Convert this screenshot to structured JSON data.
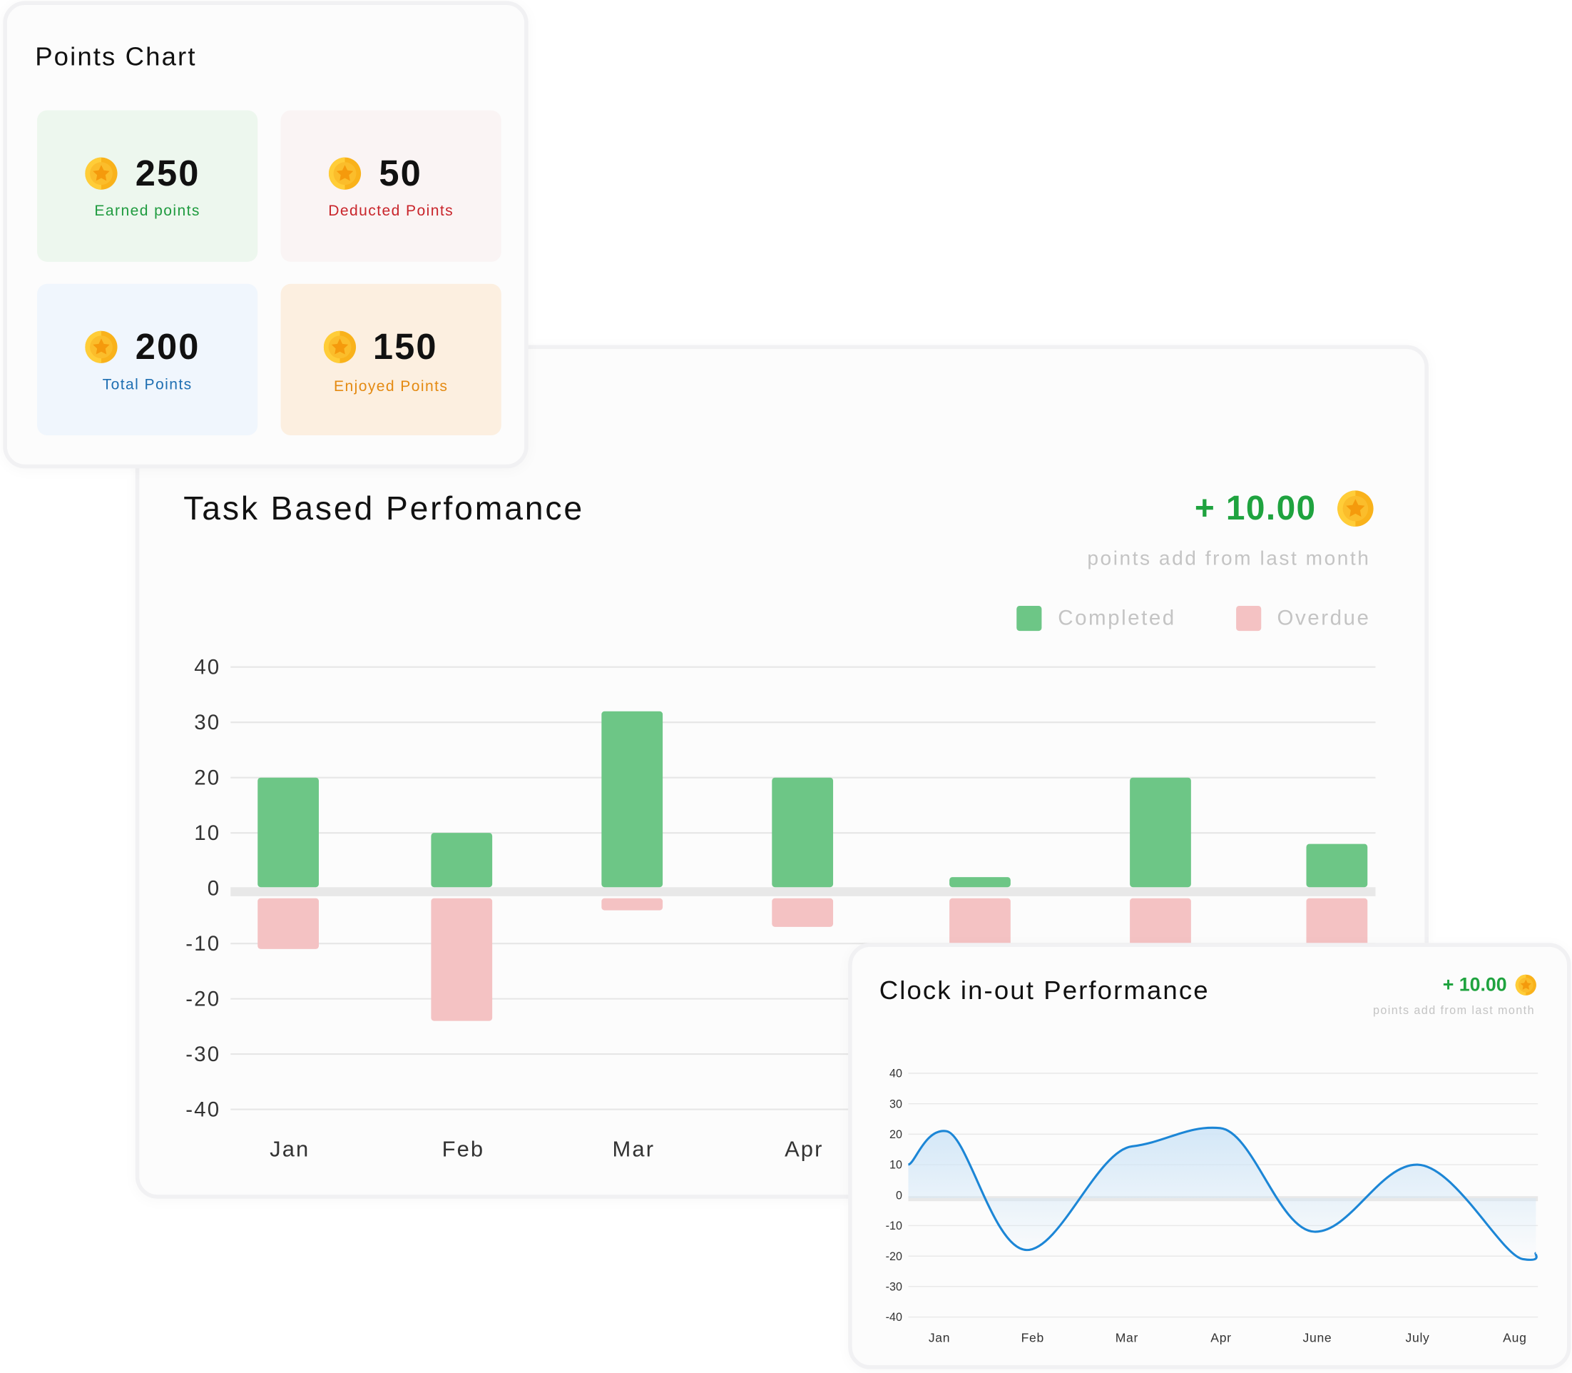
{
  "points_card": {
    "title": "Points Chart",
    "tiles": [
      {
        "value": "250",
        "label": "Earned points",
        "label_color": "#1f9b3f",
        "bg": "#edf7ee"
      },
      {
        "value": "50",
        "label": "Deducted Points",
        "label_color": "#c9252b",
        "bg": "#faf4f4"
      },
      {
        "value": "200",
        "label": "Total Points",
        "label_color": "#1f6fb2",
        "bg": "#f0f6fd"
      },
      {
        "value": "150",
        "label": "Enjoyed Points",
        "label_color": "#e48a12",
        "bg": "#fcefe0"
      }
    ]
  },
  "task_card": {
    "title": "Task Based Perfomance",
    "delta": "+ 10.00",
    "delta_sub": "points add from last month"
  },
  "clock_card": {
    "title": "Clock in-out Performance",
    "delta": "+ 10.00",
    "delta_sub": "points add from last month"
  },
  "colors": {
    "positive": "#1fa33f",
    "completed": "#6dc686",
    "overdue": "#f4c2c3",
    "line": "#1c86d6"
  },
  "chart_data": [
    {
      "type": "bar",
      "title": "Task Based Perfomance",
      "categories": [
        "Jan",
        "Feb",
        "Mar",
        "Apr",
        "",
        "",
        ""
      ],
      "series": [
        {
          "name": "Completed",
          "values": [
            20,
            10,
            32,
            20,
            2,
            20,
            8
          ]
        },
        {
          "name": "Overdue",
          "values": [
            -11,
            -24,
            -4,
            -7,
            -12,
            -11,
            -11
          ]
        }
      ],
      "yticks": [
        "40",
        "30",
        "20",
        "10",
        "0",
        "-10",
        "-20",
        "-30",
        "-40"
      ],
      "ylim": [
        -40,
        40
      ],
      "grid": true,
      "legend": "top-right"
    },
    {
      "type": "line",
      "title": "Clock in-out Performance",
      "categories": [
        "Jan",
        "Feb",
        "Mar",
        "Apr",
        "June",
        "July",
        "Aug"
      ],
      "series": [
        {
          "values": [
            21,
            -18,
            16,
            22,
            -12,
            10,
            -21
          ]
        }
      ],
      "yticks": [
        "40",
        "30",
        "20",
        "10",
        "0",
        "-10",
        "-20",
        "-30",
        "-40"
      ],
      "ylim": [
        -40,
        40
      ],
      "grid": true,
      "smooth": true,
      "area_fill": true
    }
  ]
}
